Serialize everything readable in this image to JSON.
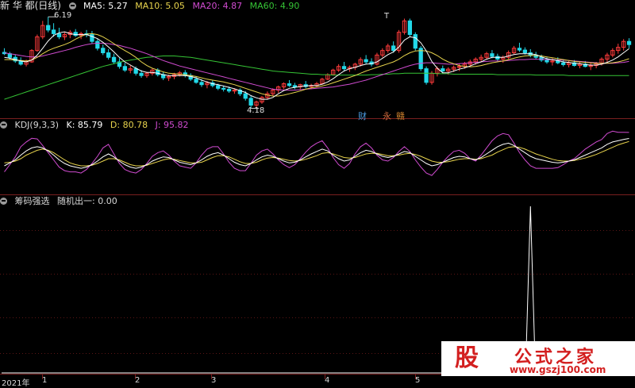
{
  "title": "新 华 都(日线)",
  "main_indicators": [
    {
      "label": "MA5: 5.27",
      "color": "#ffffff"
    },
    {
      "label": "MA10: 5.05",
      "color": "#e8d44d"
    },
    {
      "label": "MA20: 4.87",
      "color": "#d04bd0"
    },
    {
      "label": "MA60: 4.90",
      "color": "#35c435"
    }
  ],
  "annotations": {
    "high": "6.19",
    "low": "4.18",
    "t_mark": "T"
  },
  "badges": [
    {
      "label": "财",
      "color": "#4a9be0"
    },
    {
      "label": "永",
      "color": "#d06a3c"
    },
    {
      "label": "赣",
      "color": "#c87e2c"
    }
  ],
  "kdj": {
    "title": "KDJ(9,3,3)",
    "values": [
      {
        "label": "K: 85.79",
        "color": "#ffffff"
      },
      {
        "label": "D: 80.78",
        "color": "#e8d44d"
      },
      {
        "label": "J: 95.82",
        "color": "#d04bd0"
      }
    ]
  },
  "custom": {
    "title": "筹码强选",
    "value": "随机出一: 0.00"
  },
  "xaxis": {
    "labels": [
      "2021年",
      "1",
      "2",
      "3",
      "4",
      "5"
    ]
  },
  "logo": {
    "char": "股",
    "title": "公式之家",
    "url": "www.gszj100.com"
  },
  "colors": {
    "up": "#ff3b3b",
    "down": "#22d8e8",
    "grid": "#7a1f1f",
    "ma5": "#ffffff",
    "ma10": "#e8d44d",
    "ma20": "#d04bd0",
    "ma60": "#35c435"
  },
  "chart_data": {
    "type": "candlestick",
    "candles": [
      [
        5.41,
        5.5,
        5.35,
        5.38
      ],
      [
        5.38,
        5.42,
        5.25,
        5.3
      ],
      [
        5.3,
        5.36,
        5.18,
        5.22
      ],
      [
        5.22,
        5.3,
        5.12,
        5.15
      ],
      [
        5.15,
        5.25,
        5.1,
        5.2
      ],
      [
        5.2,
        5.48,
        5.18,
        5.45
      ],
      [
        5.45,
        5.8,
        5.42,
        5.75
      ],
      [
        5.75,
        6.1,
        5.7,
        6.0
      ],
      [
        6.0,
        6.19,
        5.85,
        5.9
      ],
      [
        5.9,
        6.05,
        5.75,
        5.82
      ],
      [
        5.82,
        5.95,
        5.7,
        5.75
      ],
      [
        5.75,
        5.85,
        5.68,
        5.8
      ],
      [
        5.8,
        5.9,
        5.72,
        5.85
      ],
      [
        5.85,
        5.92,
        5.75,
        5.78
      ],
      [
        5.78,
        5.86,
        5.7,
        5.82
      ],
      [
        5.82,
        5.9,
        5.74,
        5.8
      ],
      [
        5.8,
        5.88,
        5.6,
        5.65
      ],
      [
        5.65,
        5.7,
        5.45,
        5.5
      ],
      [
        5.5,
        5.58,
        5.35,
        5.4
      ],
      [
        5.4,
        5.48,
        5.25,
        5.3
      ],
      [
        5.3,
        5.38,
        5.15,
        5.2
      ],
      [
        5.2,
        5.28,
        5.05,
        5.1
      ],
      [
        5.1,
        5.18,
        4.98,
        5.02
      ],
      [
        5.02,
        5.12,
        4.95,
        5.05
      ],
      [
        5.05,
        5.1,
        4.9,
        4.95
      ],
      [
        4.95,
        5.02,
        4.85,
        4.9
      ],
      [
        4.9,
        4.98,
        4.85,
        4.95
      ],
      [
        4.95,
        5.05,
        4.9,
        5.02
      ],
      [
        5.02,
        5.06,
        4.88,
        4.92
      ],
      [
        4.92,
        4.98,
        4.8,
        4.85
      ],
      [
        4.85,
        4.92,
        4.78,
        4.88
      ],
      [
        4.88,
        4.96,
        4.82,
        4.92
      ],
      [
        4.92,
        5.0,
        4.88,
        4.96
      ],
      [
        4.96,
        5.02,
        4.86,
        4.9
      ],
      [
        4.9,
        4.95,
        4.78,
        4.82
      ],
      [
        4.82,
        4.88,
        4.72,
        4.75
      ],
      [
        4.75,
        4.82,
        4.65,
        4.7
      ],
      [
        4.7,
        4.78,
        4.62,
        4.74
      ],
      [
        4.74,
        4.8,
        4.64,
        4.68
      ],
      [
        4.68,
        4.72,
        4.58,
        4.62
      ],
      [
        4.62,
        4.68,
        4.55,
        4.6
      ],
      [
        4.6,
        4.66,
        4.52,
        4.56
      ],
      [
        4.56,
        4.62,
        4.5,
        4.58
      ],
      [
        4.58,
        4.62,
        4.45,
        4.5
      ],
      [
        4.5,
        4.56,
        4.35,
        4.4
      ],
      [
        4.4,
        4.46,
        4.18,
        4.25
      ],
      [
        4.25,
        4.35,
        4.2,
        4.32
      ],
      [
        4.32,
        4.45,
        4.28,
        4.42
      ],
      [
        4.42,
        4.55,
        4.38,
        4.5
      ],
      [
        4.5,
        4.62,
        4.45,
        4.58
      ],
      [
        4.58,
        4.68,
        4.52,
        4.65
      ],
      [
        4.65,
        4.75,
        4.6,
        4.72
      ],
      [
        4.72,
        4.8,
        4.65,
        4.68
      ],
      [
        4.68,
        4.74,
        4.6,
        4.65
      ],
      [
        4.65,
        4.72,
        4.58,
        4.7
      ],
      [
        4.7,
        4.78,
        4.62,
        4.66
      ],
      [
        4.66,
        4.72,
        4.6,
        4.68
      ],
      [
        4.68,
        4.76,
        4.64,
        4.72
      ],
      [
        4.72,
        4.85,
        4.7,
        4.82
      ],
      [
        4.82,
        4.95,
        4.8,
        4.92
      ],
      [
        4.92,
        5.05,
        4.9,
        5.02
      ],
      [
        5.02,
        5.15,
        4.98,
        5.1
      ],
      [
        5.1,
        5.2,
        5.0,
        5.05
      ],
      [
        5.05,
        5.12,
        4.98,
        5.08
      ],
      [
        5.08,
        5.18,
        5.02,
        5.15
      ],
      [
        5.15,
        5.3,
        5.1,
        5.25
      ],
      [
        5.25,
        5.35,
        5.15,
        5.2
      ],
      [
        5.2,
        5.28,
        5.1,
        5.15
      ],
      [
        5.15,
        5.4,
        5.12,
        5.35
      ],
      [
        5.35,
        5.5,
        5.3,
        5.45
      ],
      [
        5.45,
        5.6,
        5.4,
        5.55
      ],
      [
        5.55,
        5.65,
        5.4,
        5.45
      ],
      [
        5.45,
        5.9,
        5.4,
        5.85
      ],
      [
        5.85,
        6.15,
        5.8,
        6.1
      ],
      [
        6.1,
        6.15,
        5.75,
        5.8
      ],
      [
        5.8,
        5.85,
        5.45,
        5.5
      ],
      [
        5.5,
        5.55,
        5.0,
        5.05
      ],
      [
        5.05,
        5.1,
        4.7,
        4.75
      ],
      [
        4.75,
        5.0,
        4.7,
        4.95
      ],
      [
        4.95,
        5.1,
        4.88,
        5.05
      ],
      [
        5.05,
        5.12,
        4.95,
        5.0
      ],
      [
        5.0,
        5.08,
        4.92,
        5.04
      ],
      [
        5.04,
        5.12,
        4.98,
        5.08
      ],
      [
        5.08,
        5.16,
        5.0,
        5.1
      ],
      [
        5.1,
        5.2,
        5.05,
        5.15
      ],
      [
        5.15,
        5.25,
        5.1,
        5.2
      ],
      [
        5.2,
        5.3,
        5.14,
        5.26
      ],
      [
        5.26,
        5.36,
        5.2,
        5.3
      ],
      [
        5.3,
        5.42,
        5.25,
        5.38
      ],
      [
        5.38,
        5.46,
        5.28,
        5.32
      ],
      [
        5.32,
        5.38,
        5.22,
        5.26
      ],
      [
        5.26,
        5.34,
        5.18,
        5.3
      ],
      [
        5.3,
        5.45,
        5.26,
        5.4
      ],
      [
        5.4,
        5.55,
        5.36,
        5.5
      ],
      [
        5.5,
        5.62,
        5.42,
        5.46
      ],
      [
        5.46,
        5.52,
        5.36,
        5.4
      ],
      [
        5.4,
        5.48,
        5.3,
        5.35
      ],
      [
        5.35,
        5.42,
        5.25,
        5.3
      ],
      [
        5.3,
        5.36,
        5.2,
        5.24
      ],
      [
        5.24,
        5.3,
        5.16,
        5.2
      ],
      [
        5.2,
        5.28,
        5.12,
        5.22
      ],
      [
        5.22,
        5.3,
        5.15,
        5.18
      ],
      [
        5.18,
        5.26,
        5.1,
        5.14
      ],
      [
        5.14,
        5.22,
        5.08,
        5.18
      ],
      [
        5.18,
        5.24,
        5.1,
        5.12
      ],
      [
        5.12,
        5.2,
        5.06,
        5.15
      ],
      [
        5.15,
        5.22,
        5.08,
        5.1
      ],
      [
        5.1,
        5.18,
        5.02,
        5.12
      ],
      [
        5.12,
        5.2,
        5.06,
        5.16
      ],
      [
        5.16,
        5.3,
        5.12,
        5.26
      ],
      [
        5.26,
        5.4,
        5.2,
        5.35
      ],
      [
        5.35,
        5.5,
        5.3,
        5.45
      ],
      [
        5.45,
        5.6,
        5.38,
        5.52
      ],
      [
        5.52,
        5.7,
        5.45,
        5.65
      ],
      [
        5.65,
        5.72,
        5.5,
        5.58
      ]
    ],
    "ma5": [
      5.3,
      5.28,
      5.25,
      5.22,
      5.2,
      5.24,
      5.35,
      5.5,
      5.66,
      5.78,
      5.84,
      5.86,
      5.82,
      5.8,
      5.8,
      5.8,
      5.76,
      5.71,
      5.63,
      5.53,
      5.42,
      5.3,
      5.2,
      5.13,
      5.06,
      5.0,
      4.97,
      4.97,
      4.95,
      4.92,
      4.9,
      4.9,
      4.9,
      4.9,
      4.88,
      4.85,
      4.8,
      4.76,
      4.72,
      4.7,
      4.67,
      4.64,
      4.61,
      4.57,
      4.53,
      4.46,
      4.41,
      4.38,
      4.38,
      4.42,
      4.5,
      4.57,
      4.62,
      4.64,
      4.66,
      4.67,
      4.68,
      4.68,
      4.71,
      4.76,
      4.83,
      4.92,
      5.0,
      5.05,
      5.08,
      5.12,
      5.15,
      5.16,
      5.2,
      5.28,
      5.36,
      5.42,
      5.53,
      5.68,
      5.75,
      5.73,
      5.62,
      5.44,
      5.21,
      5.06,
      4.96,
      4.96,
      5.0,
      5.04,
      5.07,
      5.11,
      5.16,
      5.2,
      5.26,
      5.3,
      5.3,
      5.3,
      5.33,
      5.36,
      5.38,
      5.38,
      5.38,
      5.36,
      5.31,
      5.27,
      5.25,
      5.23,
      5.2,
      5.19,
      5.17,
      5.16,
      5.14,
      5.13,
      5.13,
      5.15,
      5.19,
      5.24,
      5.31,
      5.4,
      5.49
    ],
    "ma10": [
      5.25,
      5.25,
      5.24,
      5.23,
      5.22,
      5.24,
      5.3,
      5.38,
      5.45,
      5.5,
      5.54,
      5.58,
      5.63,
      5.7,
      5.76,
      5.81,
      5.82,
      5.8,
      5.75,
      5.68,
      5.6,
      5.52,
      5.45,
      5.38,
      5.3,
      5.2,
      5.12,
      5.06,
      5.02,
      4.98,
      4.95,
      4.94,
      4.93,
      4.92,
      4.9,
      4.88,
      4.85,
      4.82,
      4.8,
      4.78,
      4.76,
      4.73,
      4.7,
      4.66,
      4.62,
      4.58,
      4.54,
      4.5,
      4.47,
      4.45,
      4.45,
      4.47,
      4.5,
      4.53,
      4.56,
      4.6,
      4.63,
      4.65,
      4.67,
      4.7,
      4.74,
      4.78,
      4.82,
      4.86,
      4.9,
      4.95,
      5.0,
      5.04,
      5.08,
      5.12,
      5.16,
      5.2,
      5.26,
      5.34,
      5.4,
      5.44,
      5.45,
      5.44,
      5.4,
      5.34,
      5.26,
      5.2,
      5.16,
      5.12,
      5.1,
      5.09,
      5.1,
      5.12,
      5.15,
      5.18,
      5.2,
      5.22,
      5.25,
      5.28,
      5.31,
      5.33,
      5.34,
      5.34,
      5.33,
      5.31,
      5.29,
      5.27,
      5.25,
      5.23,
      5.21,
      5.2,
      5.19,
      5.18,
      5.17,
      5.17,
      5.17,
      5.18,
      5.2,
      5.23,
      5.27
    ],
    "ma20": [
      5.4,
      5.38,
      5.36,
      5.34,
      5.32,
      5.31,
      5.31,
      5.33,
      5.36,
      5.39,
      5.42,
      5.45,
      5.48,
      5.52,
      5.55,
      5.58,
      5.6,
      5.61,
      5.61,
      5.6,
      5.58,
      5.56,
      5.53,
      5.5,
      5.46,
      5.42,
      5.38,
      5.33,
      5.28,
      5.23,
      5.19,
      5.15,
      5.11,
      5.08,
      5.05,
      5.02,
      4.99,
      4.96,
      4.93,
      4.9,
      4.87,
      4.84,
      4.81,
      4.78,
      4.75,
      4.72,
      4.69,
      4.66,
      4.63,
      4.6,
      4.59,
      4.58,
      4.58,
      4.58,
      4.59,
      4.6,
      4.61,
      4.62,
      4.63,
      4.64,
      4.65,
      4.67,
      4.69,
      4.71,
      4.74,
      4.77,
      4.8,
      4.84,
      4.88,
      4.92,
      4.96,
      5.0,
      5.04,
      5.08,
      5.12,
      5.15,
      5.17,
      5.18,
      5.18,
      5.17,
      5.16,
      5.15,
      5.15,
      5.16,
      5.17,
      5.18,
      5.19,
      5.2,
      5.21,
      5.22,
      5.22,
      5.22,
      5.23,
      5.24,
      5.25,
      5.25,
      5.26,
      5.26,
      5.26,
      5.25,
      5.25,
      5.24,
      5.24,
      5.23,
      5.22,
      5.21,
      5.2,
      5.19,
      5.18,
      5.17,
      5.17,
      5.17,
      5.18,
      5.19,
      5.21
    ],
    "ma60": [
      4.38,
      4.42,
      4.46,
      4.5,
      4.54,
      4.58,
      4.62,
      4.66,
      4.7,
      4.74,
      4.78,
      4.82,
      4.86,
      4.9,
      4.94,
      4.98,
      5.02,
      5.06,
      5.1,
      5.13,
      5.16,
      5.19,
      5.22,
      5.24,
      5.26,
      5.28,
      5.3,
      5.31,
      5.32,
      5.33,
      5.33,
      5.33,
      5.32,
      5.31,
      5.3,
      5.28,
      5.26,
      5.24,
      5.22,
      5.2,
      5.18,
      5.16,
      5.14,
      5.12,
      5.1,
      5.08,
      5.06,
      5.04,
      5.02,
      5.0,
      4.99,
      4.98,
      4.97,
      4.96,
      4.95,
      4.94,
      4.93,
      4.93,
      4.92,
      4.92,
      4.91,
      4.91,
      4.91,
      4.91,
      4.91,
      4.91,
      4.91,
      4.92,
      4.92,
      4.93,
      4.93,
      4.94,
      4.94,
      4.95,
      4.95,
      4.95,
      4.95,
      4.95,
      4.95,
      4.94,
      4.94,
      4.94,
      4.93,
      4.93,
      4.93,
      4.93,
      4.93,
      4.93,
      4.93,
      4.93,
      4.92,
      4.92,
      4.92,
      4.92,
      4.92,
      4.92,
      4.92,
      4.91,
      4.91,
      4.91,
      4.91,
      4.91,
      4.91,
      4.9,
      4.9,
      4.9,
      4.9,
      4.9,
      4.9,
      4.9,
      4.9,
      4.9,
      4.9,
      4.9,
      4.9
    ],
    "ylim": [
      4.05,
      6.35
    ],
    "kdj_k": [
      40,
      45,
      50,
      58,
      65,
      70,
      72,
      70,
      65,
      58,
      50,
      44,
      40,
      38,
      36,
      38,
      42,
      48,
      55,
      60,
      55,
      48,
      42,
      38,
      36,
      38,
      42,
      48,
      52,
      55,
      54,
      50,
      46,
      44,
      42,
      45,
      50,
      56,
      60,
      62,
      58,
      52,
      46,
      42,
      40,
      44,
      50,
      55,
      58,
      56,
      52,
      48,
      45,
      46,
      50,
      55,
      60,
      64,
      68,
      65,
      58,
      52,
      48,
      50,
      56,
      62,
      66,
      64,
      60,
      56,
      54,
      56,
      60,
      64,
      62,
      56,
      50,
      44,
      40,
      42,
      46,
      50,
      54,
      56,
      55,
      52,
      50,
      54,
      60,
      66,
      72,
      76,
      78,
      74,
      68,
      62,
      56,
      52,
      50,
      48,
      46,
      45,
      46,
      48,
      50,
      54,
      58,
      62,
      66,
      70,
      76,
      80,
      82,
      84,
      85.79
    ],
    "kdj_d": [
      45,
      46,
      48,
      52,
      58,
      62,
      66,
      68,
      66,
      62,
      56,
      50,
      45,
      42,
      40,
      40,
      41,
      44,
      48,
      52,
      52,
      50,
      46,
      42,
      40,
      40,
      41,
      44,
      47,
      50,
      52,
      51,
      49,
      47,
      45,
      45,
      46,
      50,
      54,
      57,
      57,
      55,
      51,
      47,
      44,
      44,
      46,
      50,
      53,
      54,
      53,
      51,
      49,
      48,
      49,
      51,
      54,
      57,
      61,
      62,
      60,
      57,
      54,
      53,
      54,
      57,
      60,
      61,
      61,
      59,
      57,
      57,
      58,
      60,
      61,
      59,
      56,
      52,
      48,
      46,
      46,
      47,
      49,
      51,
      52,
      52,
      51,
      52,
      55,
      58,
      63,
      67,
      71,
      72,
      71,
      68,
      64,
      60,
      57,
      54,
      51,
      49,
      48,
      48,
      49,
      51,
      53,
      56,
      59,
      63,
      67,
      71,
      75,
      78,
      80.78
    ],
    "kdj_j": [
      30,
      42,
      55,
      72,
      80,
      86,
      85,
      74,
      62,
      50,
      38,
      32,
      30,
      30,
      28,
      34,
      44,
      56,
      70,
      76,
      60,
      44,
      34,
      30,
      28,
      34,
      44,
      56,
      62,
      65,
      58,
      48,
      40,
      38,
      36,
      45,
      58,
      68,
      72,
      72,
      60,
      46,
      36,
      32,
      32,
      44,
      58,
      65,
      68,
      60,
      50,
      42,
      37,
      42,
      52,
      63,
      72,
      78,
      82,
      70,
      54,
      42,
      36,
      44,
      60,
      72,
      78,
      70,
      58,
      50,
      48,
      54,
      64,
      72,
      64,
      50,
      38,
      28,
      24,
      34,
      46,
      56,
      64,
      66,
      61,
      52,
      48,
      58,
      70,
      82,
      90,
      94,
      92,
      78,
      62,
      50,
      40,
      36,
      36,
      36,
      36,
      37,
      42,
      48,
      52,
      60,
      68,
      74,
      80,
      84,
      94,
      98,
      96,
      96,
      95.82
    ],
    "signal": {
      "index": 96,
      "value": 1.0
    }
  }
}
